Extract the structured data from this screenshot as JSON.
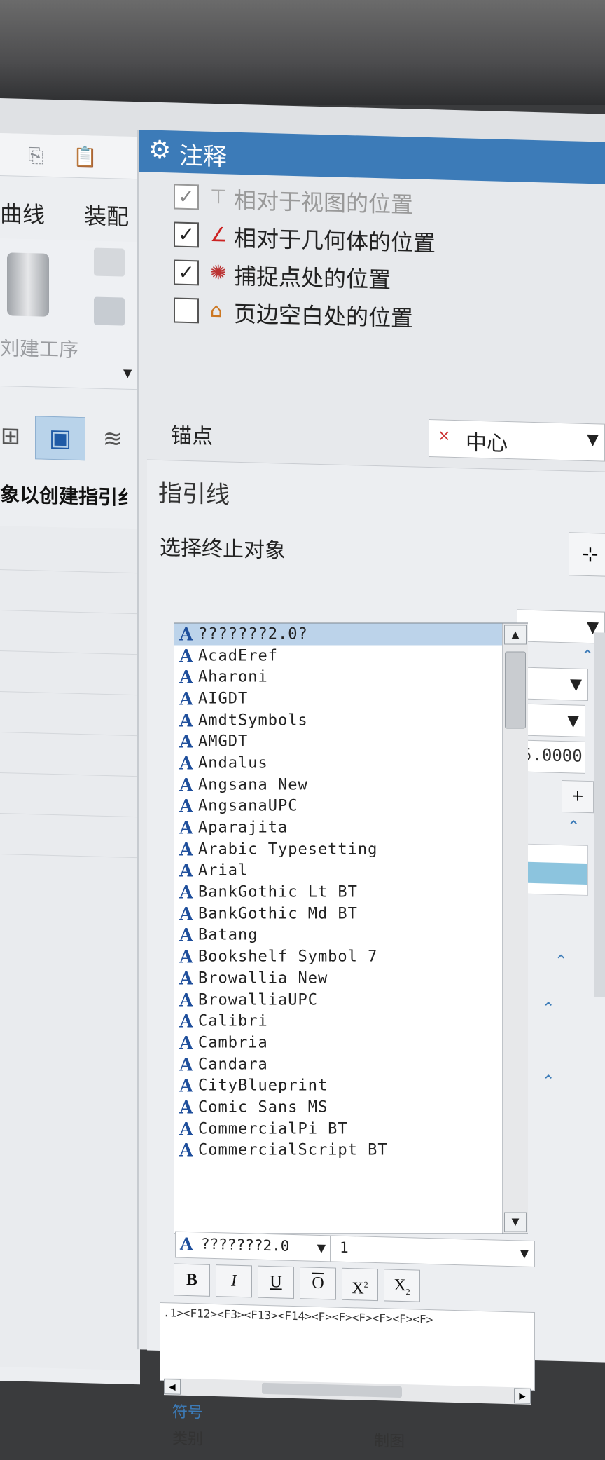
{
  "left_panel": {
    "menu": [
      "曲线",
      "装配"
    ],
    "ribbon_label": "刘建工序",
    "selection_hint": "象以创建指引纟"
  },
  "dialog": {
    "title": "注释",
    "origin_options": [
      {
        "label": "相对于视图的位置",
        "checked": true,
        "enabled": false
      },
      {
        "label": "相对于几何体的位置",
        "checked": true,
        "enabled": true
      },
      {
        "label": "捕捉点处的位置",
        "checked": true,
        "enabled": true
      },
      {
        "label": "页边空白处的位置",
        "checked": false,
        "enabled": true
      }
    ],
    "anchor": {
      "label": "锚点",
      "value": "中心"
    },
    "leader": {
      "title": "指引线",
      "select_end": "选择终止对象"
    },
    "background_value": "5.0000",
    "font_list": {
      "selected": "???????2.0?",
      "items": [
        "???????2.0?",
        "AcadEref",
        "Aharoni",
        "AIGDT",
        "AmdtSymbols",
        "AMGDT",
        "Andalus",
        "Angsana New",
        "AngsanaUPC",
        "Aparajita",
        "Arabic Typesetting",
        "Arial",
        "BankGothic Lt BT",
        "BankGothic Md BT",
        "Batang",
        "Bookshelf Symbol 7",
        "Browallia New",
        "BrowalliaUPC",
        "Calibri",
        "Cambria",
        "Candara",
        "CityBlueprint",
        "Comic Sans MS",
        "CommercialPi BT",
        "CommercialScript BT"
      ]
    },
    "font_combo": "???????2.0",
    "size_combo": "1",
    "format_buttons": {
      "bold": "B",
      "italic": "I",
      "underline": "U",
      "overline": "O",
      "superscript": "X",
      "subscript": "X"
    },
    "text_code": ".1><F12><F3><F13><F14><F><F><F><F><F><F>",
    "symbol_label": "符号",
    "category_label": "类别",
    "category_value": "制图"
  }
}
